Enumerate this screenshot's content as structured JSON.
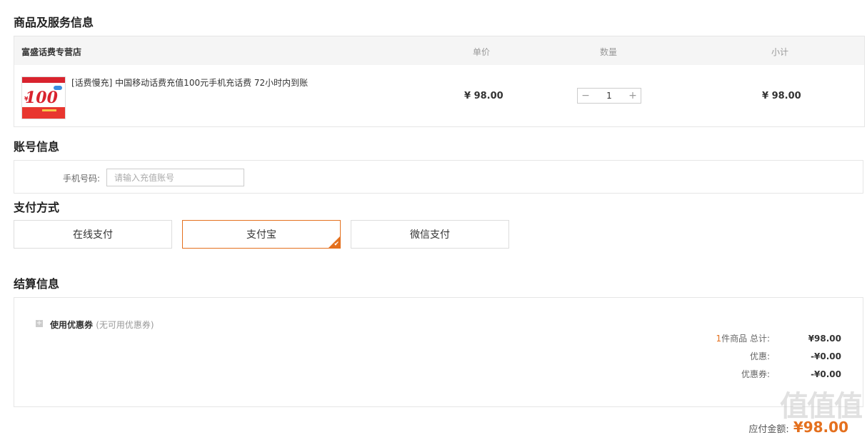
{
  "sections": {
    "product": "商品及服务信息",
    "account": "账号信息",
    "payment": "支付方式",
    "settlement": "结算信息"
  },
  "product_table": {
    "shop_name": "富盛话费专营店",
    "col_price": "单价",
    "col_qty": "数量",
    "col_subtotal": "小计",
    "item": {
      "name": "[话费慢充] 中国移动话费充值100元手机充话费 72小时内到账",
      "price": "¥ 98.00",
      "qty": "1",
      "subtotal": "¥ 98.00",
      "thumb_text": "100",
      "thumb_currency": "¥"
    },
    "minus": "−",
    "plus": "+"
  },
  "account": {
    "label": "手机号码:",
    "placeholder": "请输入充值账号"
  },
  "payment": {
    "options": [
      {
        "label": "在线支付",
        "selected": false
      },
      {
        "label": "支付宝",
        "selected": true
      },
      {
        "label": "微信支付",
        "selected": false
      }
    ],
    "accent": "#e4701e",
    "check": "✔"
  },
  "settlement": {
    "coupon_toggle": "+",
    "coupon_label": "使用优惠券",
    "coupon_note": "(无可用优惠券)",
    "count_text": "1",
    "total_label": "件商品 总计:",
    "total_value": "¥98.00",
    "discount_label": "优惠:",
    "discount_value": "-¥0.00",
    "coupon_label2": "优惠券:",
    "coupon_value": "-¥0.00",
    "pay_label": "应付金额:",
    "pay_value": "¥98.00"
  },
  "watermark": "值值值"
}
